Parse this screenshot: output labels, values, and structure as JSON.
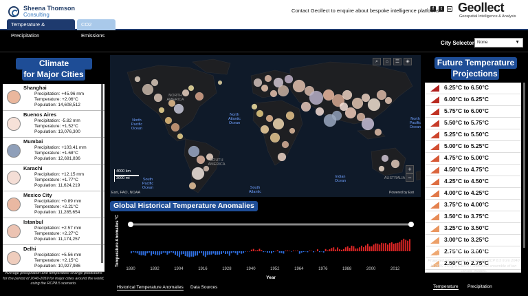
{
  "header": {
    "brand_name": "Sheena Thomson",
    "brand_sub": "Consulting",
    "contact": "Contact Geollect to enquire about bespoke intelligence platforms",
    "geollect": "Geollect",
    "geollect_sub": "Geospatial Intelligence & Analysis"
  },
  "tabs": [
    "Temperature & Precipitation",
    "CO2 Emissions"
  ],
  "city_selector": {
    "label": "City Selector",
    "value": "None"
  },
  "left_panel": {
    "title_line1": "Climate Projections",
    "title_line2": "for Major Cities",
    "cities": [
      {
        "name": "Shanghai",
        "precipitation": "Precipitation: +45.96 mm",
        "temperature": "Temperature: +2.06°C",
        "population": "Population: 14,608,512",
        "color": "#eab79d"
      },
      {
        "name": "Buenos Aires",
        "precipitation": "Precipitation: -5.82 mm",
        "temperature": "Temperature: +1.52°C",
        "population": "Population: 13,076,300",
        "color": "#f6e1d8"
      },
      {
        "name": "Mumbai",
        "precipitation": "Precipitation: +103.41 mm",
        "temperature": "Temperature: +1.68°C",
        "population": "Population: 12,691,836",
        "color": "#8f9fb9"
      },
      {
        "name": "Karachi",
        "precipitation": "Precipitation: +12.15 mm",
        "temperature": "Temperature: +1.77°C",
        "population": "Population: 11,624,219",
        "color": "#f4ded6"
      },
      {
        "name": "Mexico City",
        "precipitation": "Precipitation: +0.89 mm",
        "temperature": "Temperature: +2.21°C",
        "population": "Population: 11,285,654",
        "color": "#e9b8a2"
      },
      {
        "name": "Istanbul",
        "precipitation": "Precipitation: +2.57 mm",
        "temperature": "Temperature: +2.27°C",
        "population": "Population: 11,174,257",
        "color": "#ecc3b2"
      },
      {
        "name": "Delhi",
        "precipitation": "Precipitation: +5.56 mm",
        "temperature": "Temperature: +2.15°C",
        "population": "Population: 10,927,986",
        "color": "#efcdbd"
      }
    ],
    "footnote": "Average precipitation and temperature change predictions for the period of 2040-2059 for major cities around the world, using the RCP8.5 scenario."
  },
  "map": {
    "labels": {
      "north_america": "NORTH AMERICA",
      "north_pacific_left": "North Pacific Ocean",
      "north_atlantic": "North Atlantic Ocean",
      "north_pacific_right": "North Pacific Ocean",
      "south_america": "SOUTH AMERICA",
      "south_pacific": "South Pacific Ocean",
      "south_atlantic": "South Atlantic",
      "indian": "Indian Ocean",
      "australia": "AUSTRALIA"
    },
    "scale_km": "4000 km",
    "scale_mi": "3000 mi",
    "attribution": "Esri, FAO, NOAA",
    "powered": "Powered by Esri"
  },
  "chart": {
    "title": "Global Historical Temperature Anomalies",
    "chart_data": {
      "type": "bar",
      "ylabel": "Temperature Anomalies °C",
      "xlabel": "Year",
      "tick_labels": [
        "1880",
        "1892",
        "1904",
        "1916",
        "1928",
        "1940",
        "1952",
        "1964",
        "1976",
        "1988",
        "2000",
        "2012"
      ],
      "xlim": [
        1880,
        2019
      ],
      "ylim": [
        -1,
        1
      ],
      "values": [
        -0.16,
        -0.08,
        -0.1,
        -0.17,
        -0.28,
        -0.33,
        -0.31,
        -0.36,
        -0.17,
        -0.1,
        -0.35,
        -0.22,
        -0.27,
        -0.31,
        -0.32,
        -0.23,
        -0.11,
        -0.11,
        -0.27,
        -0.17,
        -0.08,
        -0.15,
        -0.28,
        -0.37,
        -0.47,
        -0.26,
        -0.22,
        -0.39,
        -0.43,
        -0.48,
        -0.43,
        -0.44,
        -0.36,
        -0.34,
        -0.15,
        -0.14,
        -0.36,
        -0.46,
        -0.3,
        -0.27,
        -0.27,
        -0.19,
        -0.29,
        -0.27,
        -0.27,
        -0.22,
        -0.11,
        -0.22,
        -0.2,
        -0.36,
        -0.16,
        -0.09,
        -0.16,
        -0.29,
        -0.12,
        -0.2,
        -0.15,
        -0.03,
        0,
        -0.02,
        0.13,
        0.19,
        0.07,
        0.09,
        0.2,
        0.09,
        -0.07,
        -0.03,
        -0.11,
        -0.11,
        -0.17,
        -0.07,
        0.01,
        0.08,
        -0.13,
        -0.14,
        -0.19,
        0.05,
        0.06,
        0.03,
        -0.03,
        0.06,
        0.03,
        0.05,
        -0.2,
        -0.11,
        -0.06,
        -0.02,
        -0.08,
        0.05,
        0.03,
        -0.08,
        0.01,
        0.16,
        -0.07,
        -0.01,
        -0.1,
        0.18,
        0.07,
        0.16,
        0.26,
        0.32,
        0.14,
        0.31,
        0.16,
        0.12,
        0.18,
        0.32,
        0.39,
        0.27,
        0.45,
        0.41,
        0.22,
        0.23,
        0.32,
        0.45,
        0.33,
        0.47,
        0.61,
        0.39,
        0.4,
        0.54,
        0.63,
        0.62,
        0.54,
        0.68,
        0.64,
        0.66,
        0.54,
        0.66,
        0.72,
        0.61,
        0.65,
        0.68,
        0.75,
        0.9,
        1.01,
        0.92,
        0.85,
        0.98
      ]
    }
  },
  "bottom_tabs": [
    "Historical Temperature Anomalies",
    "Data Sources"
  ],
  "right_panel": {
    "title_line1": "Future Temperature",
    "title_line2": "Projections",
    "legend": [
      {
        "label": "6.25°C to 6.50°C",
        "color": "#b0201f"
      },
      {
        "label": "6.00°C to 6.25°C",
        "color": "#b8291f"
      },
      {
        "label": "5.75°C to 6.00°C",
        "color": "#c13223"
      },
      {
        "label": "5.50°C to 5.75°C",
        "color": "#c73b28"
      },
      {
        "label": "5.25°C to 5.50°C",
        "color": "#cd452d"
      },
      {
        "label": "5.00°C to 5.25°C",
        "color": "#d24f32"
      },
      {
        "label": "4.75°C to 5.00°C",
        "color": "#d65936"
      },
      {
        "label": "4.50°C to 4.75°C",
        "color": "#da643c"
      },
      {
        "label": "4.25°C to 4.50°C",
        "color": "#de6e42"
      },
      {
        "label": "4.00°C to 4.25°C",
        "color": "#e17848"
      },
      {
        "label": "3.75°C to 4.00°C",
        "color": "#e4824f"
      },
      {
        "label": "3.50°C to 3.75°C",
        "color": "#e78c57"
      },
      {
        "label": "3.25°C to 3.50°C",
        "color": "#ea965f"
      },
      {
        "label": "3.00°C to 3.25°C",
        "color": "#ec9f68"
      },
      {
        "label": "2.75°C to 3.00°C",
        "color": "#eea872"
      },
      {
        "label": "2.50°C to 2.75°C",
        "color": "#f0b17c"
      }
    ],
    "footnote_bold": "Turn the Temperature layer on in the layer list to view the global temperature projections.",
    "footnote": "Projected temperature anomaly for RCP 8.5 from 2040 to 2059 using a CMIP5 multimodel ensemble of ten climate models.",
    "tabs": [
      "Temperature",
      "Precipitation"
    ]
  }
}
